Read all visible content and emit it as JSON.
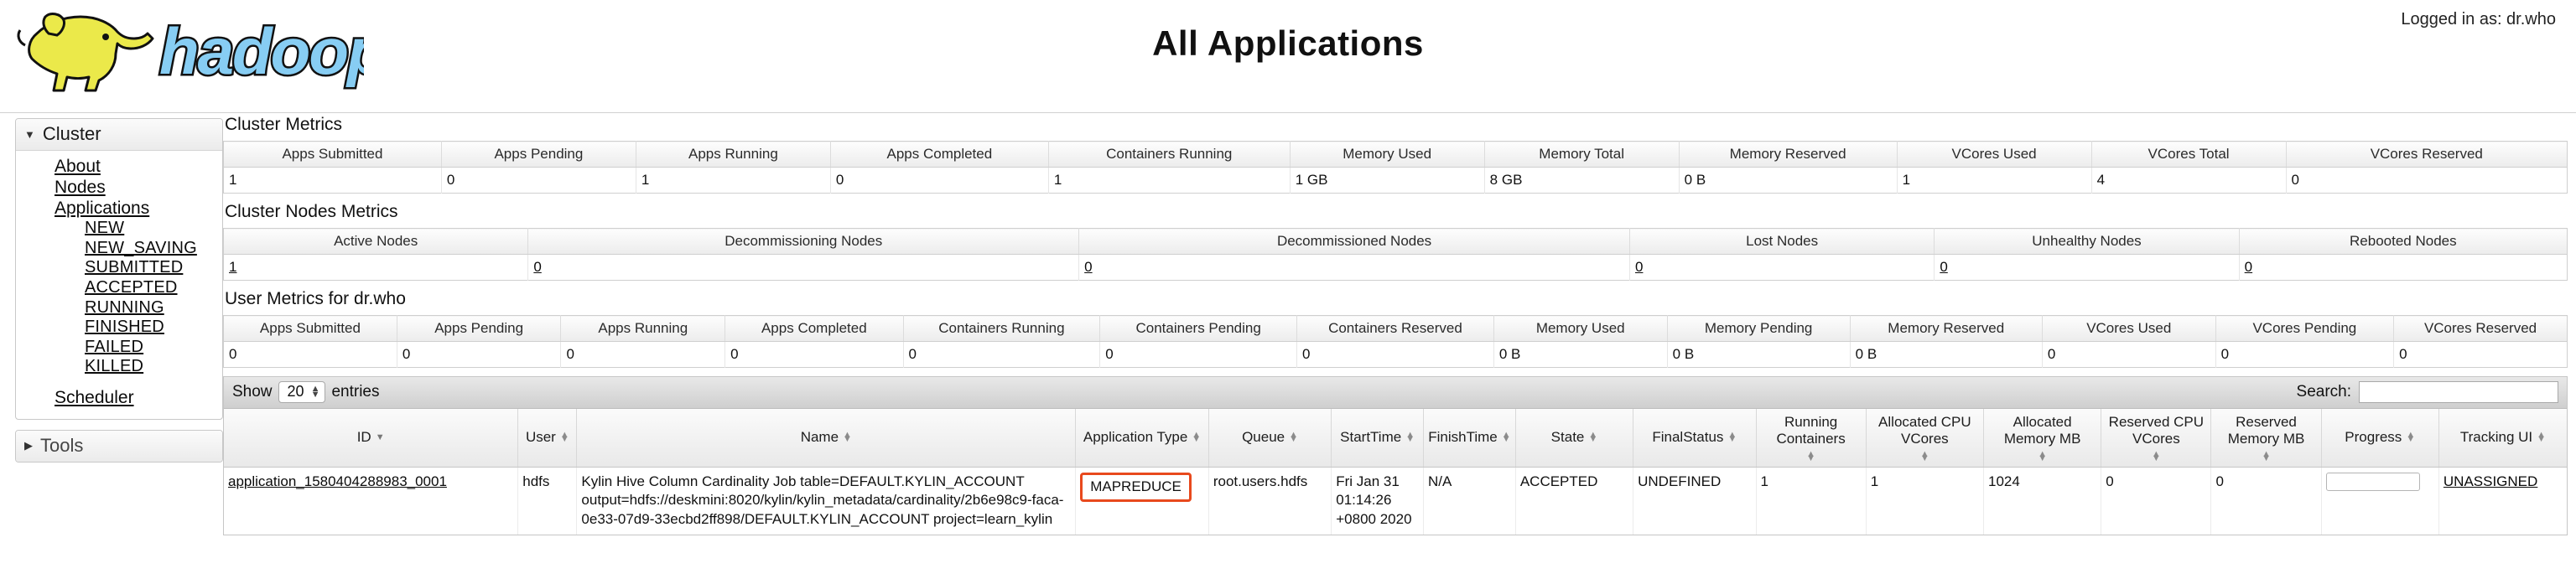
{
  "header": {
    "title": "All Applications",
    "login_text": "Logged in as: dr.who",
    "logo_alt": "hadoop"
  },
  "sidebar": {
    "cluster": {
      "label": "Cluster",
      "expanded_icon": "caret-down-icon",
      "items": [
        {
          "label": "About"
        },
        {
          "label": "Nodes"
        },
        {
          "label": "Applications"
        }
      ],
      "application_states": [
        {
          "label": "NEW"
        },
        {
          "label": "NEW_SAVING"
        },
        {
          "label": "SUBMITTED"
        },
        {
          "label": "ACCEPTED"
        },
        {
          "label": "RUNNING"
        },
        {
          "label": "FINISHED"
        },
        {
          "label": "FAILED"
        },
        {
          "label": "KILLED"
        }
      ],
      "scheduler": {
        "label": "Scheduler"
      }
    },
    "tools": {
      "label": "Tools",
      "collapsed_icon": "caret-right-icon"
    }
  },
  "cluster_metrics": {
    "title": "Cluster Metrics",
    "headers": [
      "Apps Submitted",
      "Apps Pending",
      "Apps Running",
      "Apps Completed",
      "Containers Running",
      "Memory Used",
      "Memory Total",
      "Memory Reserved",
      "VCores Used",
      "VCores Total",
      "VCores Reserved"
    ],
    "values": [
      "1",
      "0",
      "1",
      "0",
      "1",
      "1 GB",
      "8 GB",
      "0 B",
      "1",
      "4",
      "0"
    ]
  },
  "cluster_nodes_metrics": {
    "title": "Cluster Nodes Metrics",
    "headers": [
      "Active Nodes",
      "Decommissioning Nodes",
      "Decommissioned Nodes",
      "Lost Nodes",
      "Unhealthy Nodes",
      "Rebooted Nodes"
    ],
    "values": [
      "1",
      "0",
      "0",
      "0",
      "0",
      "0"
    ]
  },
  "user_metrics": {
    "title": "User Metrics for dr.who",
    "headers": [
      "Apps Submitted",
      "Apps Pending",
      "Apps Running",
      "Apps Completed",
      "Containers Running",
      "Containers Pending",
      "Containers Reserved",
      "Memory Used",
      "Memory Pending",
      "Memory Reserved",
      "VCores Used",
      "VCores Pending",
      "VCores Reserved"
    ],
    "values": [
      "0",
      "0",
      "0",
      "0",
      "0",
      "0",
      "0",
      "0 B",
      "0 B",
      "0 B",
      "0",
      "0",
      "0"
    ]
  },
  "datatable_toolbar": {
    "show_label": "Show",
    "entries_value": "20",
    "entries_label": "entries",
    "search_label": "Search:",
    "search_value": "",
    "search_placeholder": ""
  },
  "applications_table": {
    "headers": [
      "ID",
      "User",
      "Name",
      "Application Type",
      "Queue",
      "StartTime",
      "FinishTime",
      "State",
      "FinalStatus",
      "Running Containers",
      "Allocated CPU VCores",
      "Allocated Memory MB",
      "Reserved CPU VCores",
      "Reserved Memory MB",
      "Progress",
      "Tracking UI"
    ],
    "rows": [
      {
        "id": "application_1580404288983_0001",
        "user": "hdfs",
        "name": "Kylin Hive Column Cardinality Job table=DEFAULT.KYLIN_ACCOUNT output=hdfs://deskmini:8020/kylin/kylin_metadata/cardinality/2b6e98c9-faca-0e33-07d9-33ecbd2ff898/DEFAULT.KYLIN_ACCOUNT project=learn_kylin",
        "application_type": "MAPREDUCE",
        "queue": "root.users.hdfs",
        "start_time": "Fri Jan 31 01:14:26 +0800 2020",
        "finish_time": "N/A",
        "state": "ACCEPTED",
        "final_status": "UNDEFINED",
        "running_containers": "1",
        "allocated_cpu_vcores": "1",
        "allocated_memory_mb": "1024",
        "reserved_cpu_vcores": "0",
        "reserved_memory_mb": "0",
        "progress": "",
        "tracking_ui": "UNASSIGNED"
      }
    ]
  },
  "colors": {
    "highlight": "#e8491d",
    "logo_elephant": "#ebe94a",
    "logo_text": "#87cdf3"
  }
}
